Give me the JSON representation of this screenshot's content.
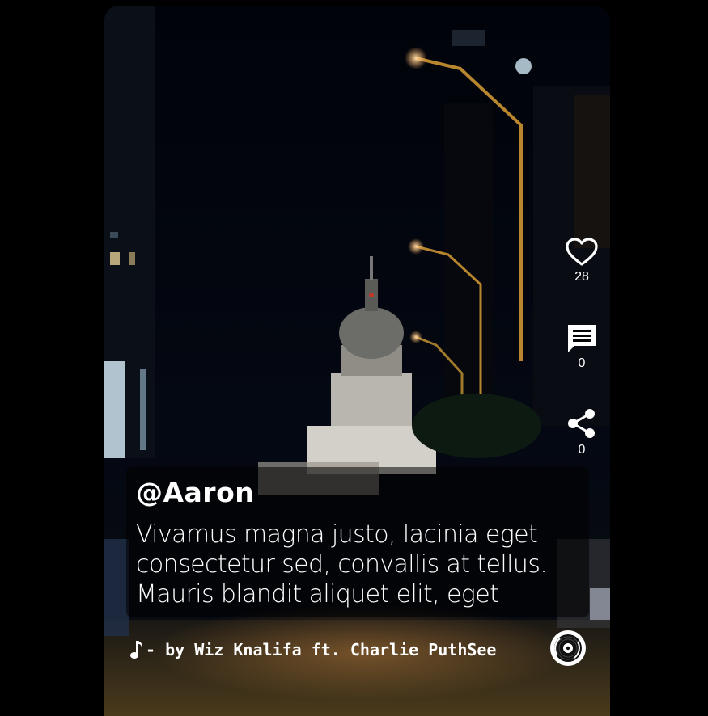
{
  "post": {
    "username": "@Aaron",
    "description_lines": [
      "Vivamus magna justo, lacinia eget",
      "consectetur sed, convallis at tellus.",
      "Mauris blandit aliquet elit, eget"
    ]
  },
  "actions": {
    "likes": "28",
    "comments": "0",
    "shares": "0"
  },
  "music": {
    "label": "- by Wiz Knalifa ft. Charlie PuthSee"
  },
  "icons": {
    "like": "heart-outline-icon",
    "comment": "comment-icon",
    "share": "share-icon",
    "music": "music-note-icon",
    "disc": "vinyl-disc-icon"
  },
  "colors": {
    "text": "#ffffff",
    "background": "#000000",
    "caption_overlay": "rgba(0,0,0,0.55)"
  }
}
